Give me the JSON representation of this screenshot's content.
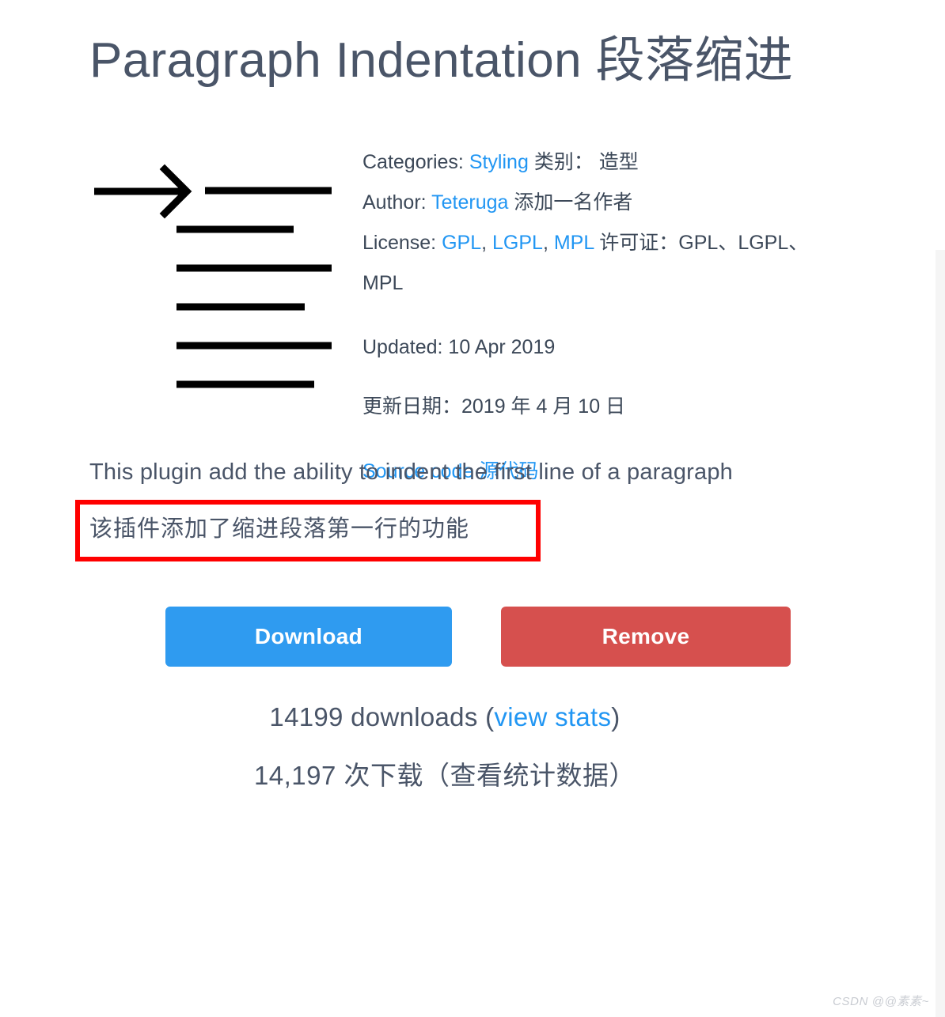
{
  "page": {
    "title": "Paragraph Indentation  段落缩进"
  },
  "icon": {
    "name": "paragraph-indent-icon"
  },
  "meta": {
    "categories": {
      "label": "Categories:",
      "link": "Styling",
      "translation": "类别： 造型"
    },
    "author": {
      "label": "Author:",
      "link": "Teteruga",
      "translation": "添加一名作者"
    },
    "license": {
      "label": "License:",
      "links": [
        "GPL",
        "LGPL",
        "MPL"
      ],
      "separator": ", ",
      "translation": "许可证：GPL、LGPL、MPL"
    },
    "updated": {
      "label": "Updated:",
      "value": "10 Apr 2019",
      "translation": "更新日期：2019 年 4 月 10 日"
    },
    "source_code": {
      "label": "Source code",
      "translation": "源代码"
    }
  },
  "description": {
    "english": "This plugin add the ability to indent the first line of a paragraph",
    "chinese": "该插件添加了缩进段落第一行的功能",
    "annotation_color": "#ff0000"
  },
  "buttons": {
    "download": "Download",
    "remove": "Remove",
    "download_color": "#2f9bf0",
    "remove_color": "#d6504e"
  },
  "stats": {
    "english_count": "14199",
    "english_text": "downloads (",
    "english_link": "view stats",
    "english_close": ")",
    "chinese": "14,197 次下载（查看统计数据）"
  },
  "watermark": {
    "text": "CSDN @@素素~"
  },
  "colors": {
    "title": "#4a5568",
    "body": "#4a5568",
    "meta": "#3c4858",
    "link": "#2196f3",
    "gutter": "#f5f5f5"
  }
}
